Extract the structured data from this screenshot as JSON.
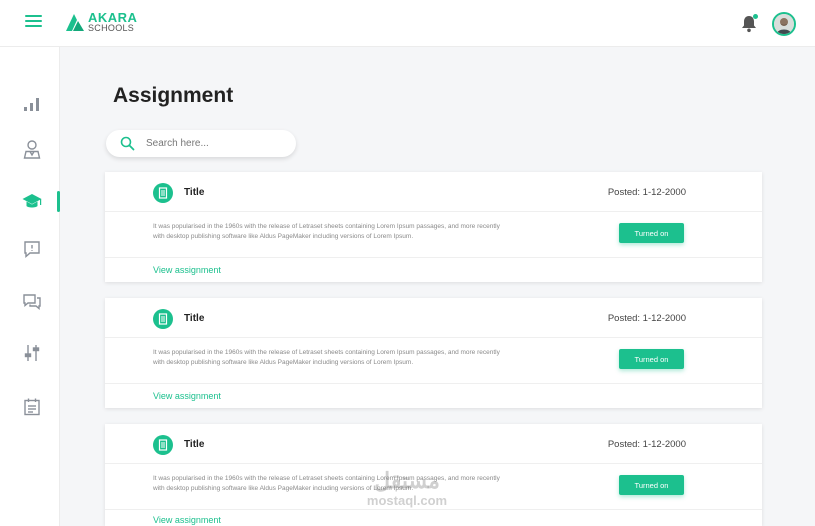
{
  "app": {
    "brand_top": "AKARA",
    "brand_bottom": "SCHOOLS",
    "accent_color": "#1cc08e"
  },
  "header": {
    "menu_icon": "hamburger-icon",
    "notification_icon": "bell-icon",
    "avatar_icon": "user-avatar"
  },
  "sidebar": {
    "items": [
      {
        "name": "stats",
        "icon": "bar-chart-icon"
      },
      {
        "name": "profile",
        "icon": "user-icon"
      },
      {
        "name": "assignments",
        "icon": "graduation-cap-icon",
        "active": true
      },
      {
        "name": "alerts",
        "icon": "message-alert-icon"
      },
      {
        "name": "chat",
        "icon": "chat-bubbles-icon"
      },
      {
        "name": "settings",
        "icon": "sliders-icon"
      },
      {
        "name": "calendar",
        "icon": "calendar-icon"
      }
    ]
  },
  "page": {
    "title": "Assignment"
  },
  "search": {
    "placeholder": "Search here..."
  },
  "assignments": [
    {
      "title": "Title",
      "posted": "Posted: 1-12-2000",
      "description": "It was popularised in the 1960s with the release of Letraset sheets containing Lorem Ipsum passages, and more recently with desktop publishing software like Aldus PageMaker including versions of Lorem Ipsum.",
      "status_label": "Turned on",
      "link_label": "View assignment"
    },
    {
      "title": "Title",
      "posted": "Posted: 1-12-2000",
      "description": "It was popularised in the 1960s with the release of Letraset sheets containing Lorem Ipsum passages, and more recently with desktop publishing software like Aldus PageMaker including versions of Lorem Ipsum.",
      "status_label": "Turned on",
      "link_label": "View assignment"
    },
    {
      "title": "Title",
      "posted": "Posted: 1-12-2000",
      "description": "It was popularised in the 1960s with the release of Letraset sheets containing Lorem Ipsum passages, and more recently with desktop publishing software like Aldus PageMaker including versions of Lorem Ipsum.",
      "status_label": "Turned on",
      "link_label": "View assignment"
    }
  ],
  "watermark": {
    "arabic": "مستقل",
    "latin": "mostaql.com"
  }
}
